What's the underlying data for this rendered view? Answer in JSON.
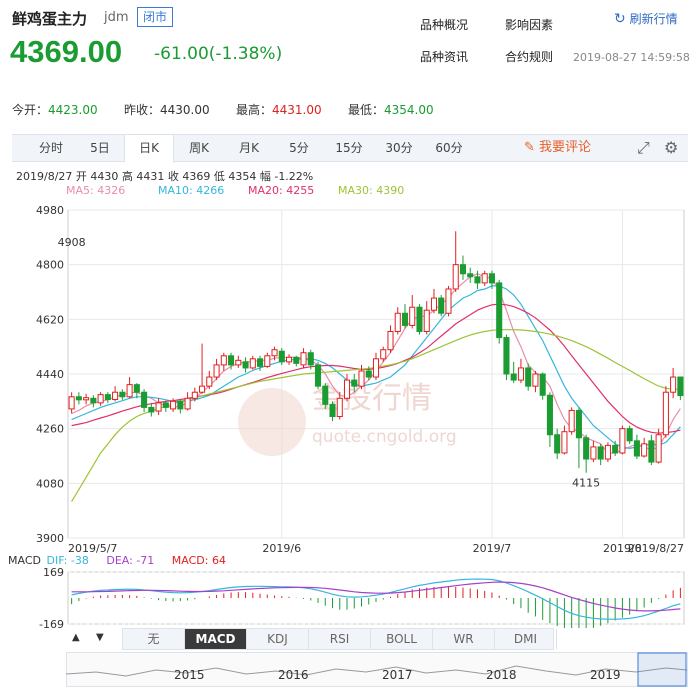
{
  "header": {
    "title": "鲜鸡蛋主力",
    "code": "jdm",
    "status": "闭市",
    "price": "4369.00",
    "change": "-61.00(-1.38%)",
    "refresh": "刷新行情",
    "timestamp": "2019-08-27 14:59:58",
    "links": [
      "品种概况",
      "影响因素",
      "品种资讯",
      "合约规则"
    ]
  },
  "stats": {
    "open_label": "今开：",
    "open": "4423.00",
    "prev_label": "昨收：",
    "prev": "4430.00",
    "high_label": "最高：",
    "high": "4431.00",
    "low_label": "最低：",
    "low": "4354.00"
  },
  "tabs": [
    "分时",
    "5日",
    "日K",
    "周K",
    "月K",
    "5分",
    "15分",
    "30分",
    "60分"
  ],
  "active_tab": "日K",
  "comment": "我要评论",
  "info": "2019/8/27  开 4430  高 4431  收 4369  低 4354  幅 -1.22%",
  "ma": [
    {
      "label": "MA5: 4326",
      "color": "#e88ea8"
    },
    {
      "label": "MA10: 4266",
      "color": "#35b6de"
    },
    {
      "label": "MA20: 4255",
      "color": "#e0306a"
    },
    {
      "label": "MA30: 4390",
      "color": "#9cc435"
    }
  ],
  "watermark": {
    "cn": "金投行情",
    "url": "quote.cngold.org"
  },
  "macd_info": {
    "label": "MACD",
    "dif": "DIF: -38",
    "dea": "DEA: -71",
    "macd": "MACD: 64"
  },
  "indicator_tabs": [
    "无",
    "MACD",
    "KDJ",
    "RSI",
    "BOLL",
    "WR",
    "DMI"
  ],
  "active_indicator": "MACD",
  "nav_arrows": [
    "▲",
    "▼"
  ],
  "colors": {
    "up": "#e02020",
    "down": "#1a9c32",
    "grid": "#e8e8e8"
  },
  "chart_data": {
    "type": "candlestick",
    "ylim": [
      3900,
      4980
    ],
    "yticks": [
      4980,
      4800,
      4620,
      4440,
      4260,
      4080,
      3900
    ],
    "xtick_labels": [
      "2019/5/7",
      "2019/6",
      "2019/7",
      "2019/8",
      "2019/8/27"
    ],
    "annotations": [
      {
        "label": "4908",
        "value": 4908
      },
      {
        "label": "4115",
        "value": 4115
      }
    ],
    "candles": [
      [
        4325,
        4365,
        4380,
        4310
      ],
      [
        4365,
        4355,
        4380,
        4340
      ],
      [
        4355,
        4362,
        4375,
        4340
      ],
      [
        4360,
        4345,
        4370,
        4330
      ],
      [
        4345,
        4372,
        4380,
        4335
      ],
      [
        4372,
        4356,
        4380,
        4345
      ],
      [
        4356,
        4380,
        4400,
        4350
      ],
      [
        4380,
        4365,
        4390,
        4355
      ],
      [
        4365,
        4405,
        4430,
        4360
      ],
      [
        4405,
        4380,
        4410,
        4360
      ],
      [
        4380,
        4330,
        4390,
        4315
      ],
      [
        4330,
        4315,
        4345,
        4300
      ],
      [
        4318,
        4345,
        4360,
        4305
      ],
      [
        4345,
        4330,
        4350,
        4315
      ],
      [
        4325,
        4350,
        4360,
        4315
      ],
      [
        4350,
        4325,
        4355,
        4310
      ],
      [
        4325,
        4360,
        4380,
        4320
      ],
      [
        4360,
        4380,
        4395,
        4350
      ],
      [
        4380,
        4400,
        4540,
        4375
      ],
      [
        4400,
        4430,
        4450,
        4390
      ],
      [
        4430,
        4470,
        4490,
        4420
      ],
      [
        4470,
        4500,
        4510,
        4450
      ],
      [
        4500,
        4470,
        4510,
        4455
      ],
      [
        4470,
        4485,
        4500,
        4460
      ],
      [
        4480,
        4460,
        4495,
        4445
      ],
      [
        4460,
        4490,
        4500,
        4455
      ],
      [
        4490,
        4465,
        4500,
        4450
      ],
      [
        4465,
        4500,
        4510,
        4460
      ],
      [
        4500,
        4520,
        4530,
        4485
      ],
      [
        4515,
        4480,
        4525,
        4470
      ],
      [
        4480,
        4495,
        4505,
        4470
      ],
      [
        4495,
        4475,
        4500,
        4465
      ],
      [
        4470,
        4510,
        4525,
        4460
      ],
      [
        4510,
        4470,
        4520,
        4455
      ],
      [
        4470,
        4400,
        4480,
        4390
      ],
      [
        4400,
        4340,
        4410,
        4325
      ],
      [
        4340,
        4300,
        4350,
        4285
      ],
      [
        4300,
        4360,
        4380,
        4290
      ],
      [
        4360,
        4420,
        4440,
        4350
      ],
      [
        4420,
        4400,
        4440,
        4380
      ],
      [
        4400,
        4450,
        4470,
        4390
      ],
      [
        4450,
        4430,
        4465,
        4420
      ],
      [
        4430,
        4490,
        4510,
        4420
      ],
      [
        4490,
        4520,
        4530,
        4480
      ],
      [
        4520,
        4580,
        4600,
        4510
      ],
      [
        4580,
        4640,
        4660,
        4570
      ],
      [
        4640,
        4600,
        4670,
        4590
      ],
      [
        4600,
        4660,
        4700,
        4590
      ],
      [
        4660,
        4580,
        4670,
        4570
      ],
      [
        4580,
        4650,
        4680,
        4570
      ],
      [
        4650,
        4690,
        4720,
        4640
      ],
      [
        4690,
        4640,
        4700,
        4630
      ],
      [
        4640,
        4720,
        4730,
        4630
      ],
      [
        4720,
        4800,
        4910,
        4710
      ],
      [
        4800,
        4770,
        4830,
        4750
      ],
      [
        4770,
        4760,
        4790,
        4740
      ],
      [
        4760,
        4740,
        4780,
        4720
      ],
      [
        4740,
        4770,
        4780,
        4730
      ],
      [
        4770,
        4740,
        4780,
        4720
      ],
      [
        4740,
        4560,
        4750,
        4540
      ],
      [
        4560,
        4440,
        4570,
        4420
      ],
      [
        4440,
        4420,
        4480,
        4410
      ],
      [
        4420,
        4460,
        4490,
        4410
      ],
      [
        4460,
        4400,
        4475,
        4385
      ],
      [
        4400,
        4440,
        4450,
        4380
      ],
      [
        4440,
        4370,
        4445,
        4355
      ],
      [
        4370,
        4240,
        4380,
        4200
      ],
      [
        4240,
        4180,
        4260,
        4160
      ],
      [
        4180,
        4250,
        4270,
        4175
      ],
      [
        4250,
        4320,
        4330,
        4240
      ],
      [
        4320,
        4230,
        4330,
        4130
      ],
      [
        4230,
        4160,
        4240,
        4115
      ],
      [
        4160,
        4200,
        4220,
        4150
      ],
      [
        4200,
        4160,
        4210,
        4140
      ],
      [
        4160,
        4205,
        4215,
        4150
      ],
      [
        4205,
        4180,
        4220,
        4170
      ],
      [
        4180,
        4260,
        4270,
        4175
      ],
      [
        4260,
        4220,
        4270,
        4210
      ],
      [
        4220,
        4170,
        4240,
        4160
      ],
      [
        4170,
        4210,
        4230,
        4165
      ],
      [
        4220,
        4150,
        4240,
        4140
      ],
      [
        4150,
        4240,
        4260,
        4145
      ],
      [
        4240,
        4380,
        4400,
        4230
      ],
      [
        4380,
        4430,
        4460,
        4360
      ],
      [
        4430,
        4369,
        4431,
        4354
      ]
    ],
    "ma5": [
      4310,
      4320,
      4335,
      4345,
      4350,
      4355,
      4365,
      4372,
      4378,
      4380,
      4370,
      4360,
      4345,
      4335,
      4330,
      4335,
      4345,
      4360,
      4380,
      4400,
      4425,
      4450,
      4465,
      4475,
      4480,
      4480,
      4485,
      4485,
      4492,
      4495,
      4495,
      4495,
      4490,
      4485,
      4470,
      4440,
      4400,
      4370,
      4365,
      4380,
      4400,
      4420,
      4450,
      4480,
      4510,
      4550,
      4590,
      4620,
      4630,
      4630,
      4650,
      4670,
      4690,
      4720,
      4740,
      4760,
      4770,
      4760,
      4755,
      4715,
      4650,
      4580,
      4530,
      4470,
      4445,
      4430,
      4400,
      4340,
      4290,
      4260,
      4250,
      4230,
      4220,
      4210,
      4180,
      4180,
      4190,
      4200,
      4210,
      4200,
      4190,
      4200,
      4240,
      4290,
      4326
    ],
    "ma10": [
      4290,
      4300,
      4310,
      4320,
      4330,
      4338,
      4345,
      4352,
      4360,
      4365,
      4365,
      4363,
      4360,
      4355,
      4350,
      4350,
      4352,
      4355,
      4362,
      4370,
      4385,
      4400,
      4415,
      4430,
      4440,
      4452,
      4460,
      4468,
      4475,
      4482,
      4486,
      4488,
      4490,
      4490,
      4485,
      4475,
      4460,
      4440,
      4420,
      4405,
      4400,
      4405,
      4410,
      4420,
      4430,
      4450,
      4470,
      4500,
      4530,
      4560,
      4590,
      4620,
      4650,
      4670,
      4690,
      4700,
      4715,
      4720,
      4730,
      4730,
      4720,
      4700,
      4670,
      4630,
      4590,
      4550,
      4500,
      4450,
      4400,
      4360,
      4330,
      4300,
      4270,
      4250,
      4230,
      4210,
      4200,
      4195,
      4200,
      4205,
      4210,
      4205,
      4215,
      4240,
      4266
    ],
    "ma20": [
      4270,
      4275,
      4280,
      4288,
      4295,
      4302,
      4310,
      4318,
      4325,
      4332,
      4338,
      4342,
      4346,
      4350,
      4352,
      4356,
      4360,
      4364,
      4368,
      4372,
      4376,
      4382,
      4390,
      4398,
      4405,
      4412,
      4420,
      4428,
      4435,
      4442,
      4448,
      4454,
      4460,
      4464,
      4466,
      4468,
      4468,
      4466,
      4462,
      4458,
      4455,
      4455,
      4458,
      4462,
      4468,
      4475,
      4485,
      4495,
      4510,
      4525,
      4545,
      4565,
      4585,
      4605,
      4620,
      4635,
      4650,
      4660,
      4668,
      4670,
      4668,
      4662,
      4652,
      4640,
      4625,
      4605,
      4585,
      4560,
      4532,
      4500,
      4470,
      4440,
      4410,
      4380,
      4350,
      4325,
      4300,
      4280,
      4265,
      4255,
      4248,
      4245,
      4247,
      4250,
      4255
    ],
    "ma30": [
      4020,
      4060,
      4100,
      4140,
      4180,
      4210,
      4240,
      4265,
      4285,
      4300,
      4310,
      4318,
      4326,
      4334,
      4342,
      4350,
      4356,
      4362,
      4368,
      4374,
      4380,
      4386,
      4392,
      4398,
      4404,
      4410,
      4416,
      4420,
      4424,
      4428,
      4432,
      4436,
      4440,
      4442,
      4444,
      4446,
      4448,
      4450,
      4452,
      4454,
      4456,
      4458,
      4462,
      4466,
      4470,
      4476,
      4482,
      4490,
      4500,
      4510,
      4520,
      4530,
      4540,
      4550,
      4560,
      4568,
      4575,
      4580,
      4584,
      4586,
      4586,
      4586,
      4585,
      4583,
      4580,
      4576,
      4571,
      4565,
      4558,
      4550,
      4540,
      4530,
      4518,
      4505,
      4492,
      4478,
      4465,
      4452,
      4438,
      4425,
      4412,
      4400,
      4393,
      4390,
      4390
    ],
    "macd": {
      "ylim": [
        -169,
        169
      ],
      "yticks": [
        169,
        -169
      ],
      "dif": [
        20,
        30,
        38,
        45,
        50,
        52,
        55,
        56,
        57,
        56,
        52,
        48,
        42,
        38,
        35,
        34,
        35,
        38,
        42,
        48,
        55,
        62,
        68,
        72,
        75,
        76,
        76,
        75,
        74,
        73,
        72,
        70,
        66,
        60,
        50,
        38,
        25,
        14,
        8,
        6,
        8,
        12,
        18,
        26,
        36,
        48,
        60,
        72,
        82,
        90,
        98,
        104,
        110,
        116,
        120,
        122,
        123,
        122,
        120,
        112,
        98,
        80,
        62,
        40,
        18,
        -5,
        -30,
        -55,
        -80,
        -100,
        -115,
        -125,
        -132,
        -136,
        -138,
        -138,
        -136,
        -132,
        -125,
        -115,
        -100,
        -85,
        -68,
        -50,
        -38
      ],
      "dea": [
        40,
        40,
        40,
        41,
        42,
        43,
        45,
        46,
        48,
        49,
        50,
        50,
        49,
        48,
        46,
        44,
        43,
        42,
        42,
        43,
        45,
        47,
        50,
        53,
        56,
        59,
        62,
        64,
        66,
        67,
        68,
        69,
        69,
        68,
        66,
        63,
        58,
        52,
        46,
        40,
        36,
        33,
        31,
        31,
        32,
        35,
        39,
        44,
        50,
        56,
        62,
        68,
        74,
        80,
        86,
        91,
        95,
        99,
        102,
        104,
        103,
        100,
        95,
        88,
        78,
        66,
        52,
        36,
        20,
        4,
        -10,
        -23,
        -35,
        -46,
        -56,
        -65,
        -72,
        -78,
        -82,
        -84,
        -84,
        -82,
        -79,
        -75,
        -71
      ]
    }
  }
}
